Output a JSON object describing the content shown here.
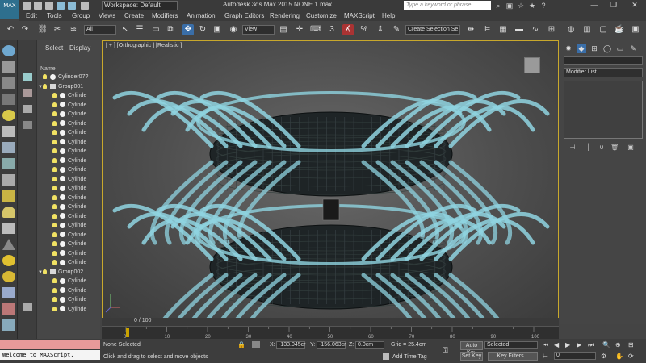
{
  "app": {
    "logo_label": "MAX",
    "workspace": "Workspace: Default",
    "title": "Autodesk 3ds Max  2015    NONE 1.max",
    "search_placeholder": "Type a keyword or phrase"
  },
  "menu": [
    "Edit",
    "Tools",
    "Group",
    "Views",
    "Create",
    "Modifiers",
    "Animation",
    "Graph Editors",
    "Rendering",
    "Customize",
    "MAXScript",
    "Help"
  ],
  "toolbar": {
    "selection_filter": "All",
    "ref_coord": "View",
    "named_selection": "Create Selection Se"
  },
  "explorer": {
    "tabs": [
      "Select",
      "Display"
    ],
    "column_header": "Name",
    "rows": [
      {
        "type": "obj",
        "label": "Cylinder07?",
        "indent": 0,
        "expand": ""
      },
      {
        "type": "grp",
        "label": "Group001",
        "indent": 0,
        "expand": "▼"
      },
      {
        "type": "obj",
        "label": "Cylinde",
        "indent": 1,
        "expand": ""
      },
      {
        "type": "obj",
        "label": "Cylinde",
        "indent": 1,
        "expand": ""
      },
      {
        "type": "obj",
        "label": "Cylinde",
        "indent": 1,
        "expand": ""
      },
      {
        "type": "obj",
        "label": "Cylinde",
        "indent": 1,
        "expand": ""
      },
      {
        "type": "obj",
        "label": "Cylinde",
        "indent": 1,
        "expand": ""
      },
      {
        "type": "obj",
        "label": "Cylinde",
        "indent": 1,
        "expand": ""
      },
      {
        "type": "obj",
        "label": "Cylinde",
        "indent": 1,
        "expand": ""
      },
      {
        "type": "obj",
        "label": "Cylinde",
        "indent": 1,
        "expand": ""
      },
      {
        "type": "obj",
        "label": "Cylinde",
        "indent": 1,
        "expand": ""
      },
      {
        "type": "obj",
        "label": "Cylinde",
        "indent": 1,
        "expand": ""
      },
      {
        "type": "obj",
        "label": "Cylinde",
        "indent": 1,
        "expand": ""
      },
      {
        "type": "obj",
        "label": "Cylinde",
        "indent": 1,
        "expand": ""
      },
      {
        "type": "obj",
        "label": "Cylinde",
        "indent": 1,
        "expand": ""
      },
      {
        "type": "obj",
        "label": "Cylinde",
        "indent": 1,
        "expand": ""
      },
      {
        "type": "obj",
        "label": "Cylinde",
        "indent": 1,
        "expand": ""
      },
      {
        "type": "obj",
        "label": "Cylinde",
        "indent": 1,
        "expand": ""
      },
      {
        "type": "obj",
        "label": "Cylinde",
        "indent": 1,
        "expand": ""
      },
      {
        "type": "obj",
        "label": "Cylinde",
        "indent": 1,
        "expand": ""
      },
      {
        "type": "obj",
        "label": "Cylinde",
        "indent": 1,
        "expand": ""
      },
      {
        "type": "grp",
        "label": "Group002",
        "indent": 0,
        "expand": "▼"
      },
      {
        "type": "obj",
        "label": "Cylinde",
        "indent": 1,
        "expand": ""
      },
      {
        "type": "obj",
        "label": "Cylinde",
        "indent": 1,
        "expand": ""
      },
      {
        "type": "obj",
        "label": "Cylinde",
        "indent": 1,
        "expand": ""
      },
      {
        "type": "obj",
        "label": "Cylinde",
        "indent": 1,
        "expand": ""
      }
    ]
  },
  "viewport": {
    "label": "[ + ] [Orthographic ] [Realistic ]",
    "border_color": "#c8a82c",
    "wire_color": "#8fd3e0"
  },
  "command_panel": {
    "modifier_list": "Modifier List"
  },
  "timeline": {
    "slider_label": "0 / 100",
    "ticks": [
      "0",
      "10",
      "20",
      "30",
      "40",
      "50",
      "60",
      "70",
      "80",
      "90",
      "100"
    ]
  },
  "status": {
    "maxscript": "Welcome to MAXScript.",
    "selection": "None Selected",
    "prompt": "Click and drag to select and move objects",
    "x_label": "X:",
    "x_value": "-133.045cr",
    "y_label": "Y:",
    "y_value": "-156.063cr",
    "z_label": "Z:",
    "z_value": "0.0cm",
    "grid": "Grid = 25.4cm",
    "add_time_tag": "Add Time Tag",
    "auto_key": "Auto Key",
    "auto_key_mode": "Selected",
    "set_key": "Set Key",
    "key_filters": "Key Filters...",
    "frame": "0"
  }
}
